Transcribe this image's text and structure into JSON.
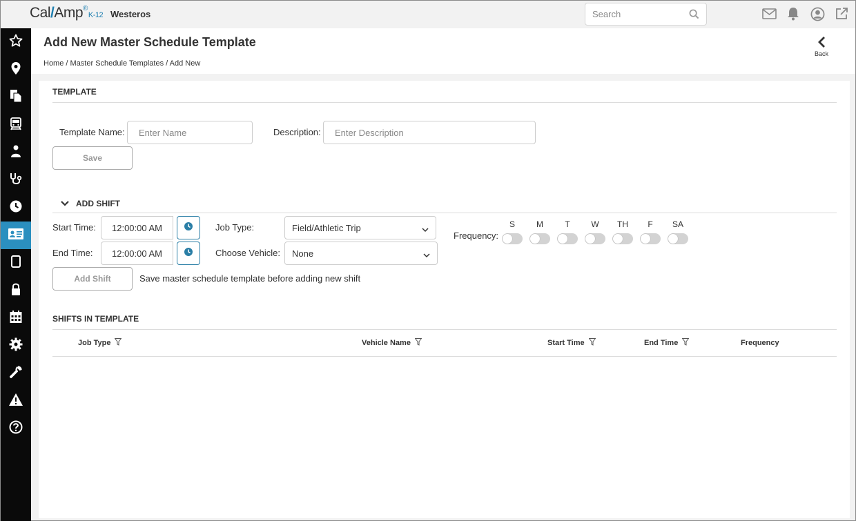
{
  "topbar": {
    "logo_left": "Cal",
    "logo_right": "Amp",
    "logo_suffix": "K-12",
    "org_name": "Westeros",
    "search_placeholder": "Search"
  },
  "header": {
    "title": "Add New Master Schedule Template",
    "breadcrumb": [
      "Home",
      "Master Schedule Templates",
      "Add New"
    ],
    "back_label": "Back"
  },
  "template_section": {
    "title": "TEMPLATE",
    "name_label": "Template Name:",
    "name_placeholder": "Enter Name",
    "description_label": "Description:",
    "description_placeholder": "Enter Description",
    "save_label": "Save"
  },
  "add_shift_section": {
    "title": "ADD SHIFT",
    "start_time_label": "Start Time:",
    "start_time_value": "12:00:00 AM",
    "end_time_label": "End Time:",
    "end_time_value": "12:00:00 AM",
    "job_type_label": "Job Type:",
    "job_type_value": "Field/Athletic Trip",
    "vehicle_label": "Choose Vehicle:",
    "vehicle_value": "None",
    "frequency_label": "Frequency:",
    "days": [
      "S",
      "M",
      "T",
      "W",
      "TH",
      "F",
      "SA"
    ],
    "add_shift_label": "Add Shift",
    "hint": "Save master schedule template before adding new shift"
  },
  "shifts_section": {
    "title": "SHIFTS IN TEMPLATE",
    "columns": [
      "Job Type",
      "Vehicle Name",
      "Start Time",
      "End Time",
      "Frequency"
    ]
  },
  "colors": {
    "accent": "#2b8fbf",
    "sidebar": "#0a0a0a"
  },
  "sidebar_icons": [
    "star-icon",
    "map-pin-icon",
    "documents-icon",
    "bus-icon",
    "student-icon",
    "stethoscope-icon",
    "clock-icon",
    "id-card-icon",
    "tablet-icon",
    "lock-icon",
    "calendar-icon",
    "gear-icon",
    "wrench-icon",
    "warning-icon",
    "help-icon"
  ]
}
